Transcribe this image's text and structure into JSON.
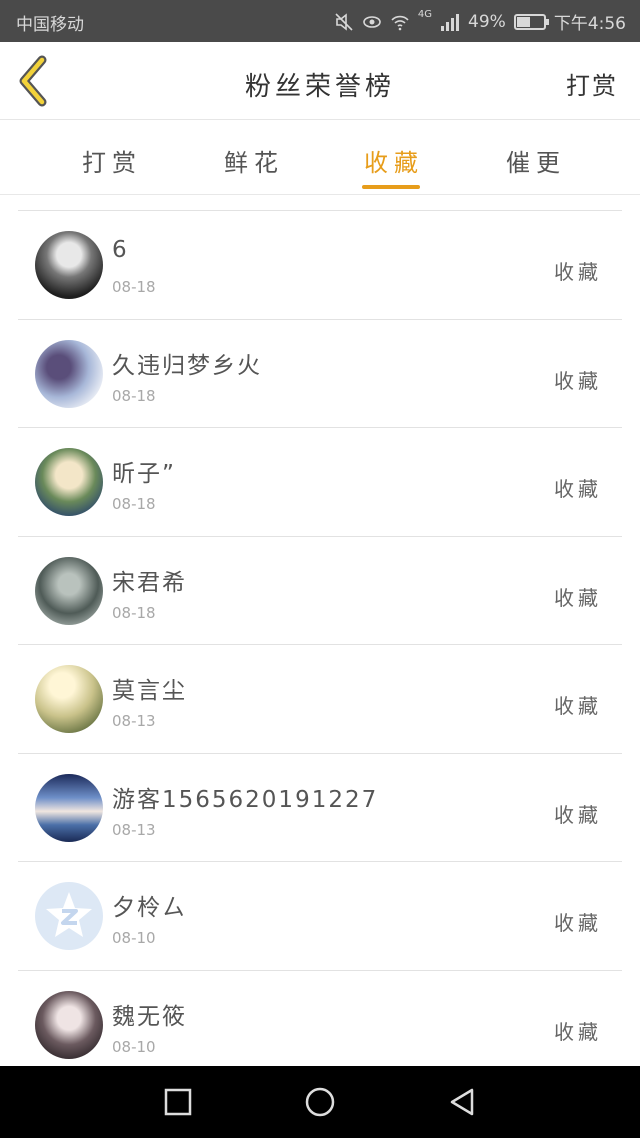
{
  "status_bar": {
    "carrier": "中国移动",
    "network": "4G",
    "battery_text": "49%",
    "battery_level": 0.49,
    "time": "下午4:56"
  },
  "header": {
    "back_icon": "chevron-left-icon",
    "title": "粉丝荣誉榜",
    "action": "打赏"
  },
  "tabs": [
    {
      "label": "打赏",
      "active": false
    },
    {
      "label": "鲜花",
      "active": false
    },
    {
      "label": "收藏",
      "active": true
    },
    {
      "label": "催更",
      "active": false
    }
  ],
  "list": [
    {
      "name": "6",
      "date": "08-18",
      "action": "收藏"
    },
    {
      "name": "久违归梦乡火",
      "date": "08-18",
      "action": "收藏"
    },
    {
      "name": "昕子”",
      "date": "08-18",
      "action": "收藏"
    },
    {
      "name": "宋君希",
      "date": "08-18",
      "action": "收藏"
    },
    {
      "name": "莫言尘",
      "date": "08-13",
      "action": "收藏"
    },
    {
      "name": "游客1565620191227",
      "date": "08-13",
      "action": "收藏"
    },
    {
      "name": "夕柃ㄙ",
      "date": "08-10",
      "action": "收藏"
    },
    {
      "name": "魏无筱",
      "date": "08-10",
      "action": "收藏"
    }
  ],
  "colors": {
    "accent": "#e79d1b",
    "status_bar": "#4a4a4a",
    "nav_bar": "#000000"
  }
}
